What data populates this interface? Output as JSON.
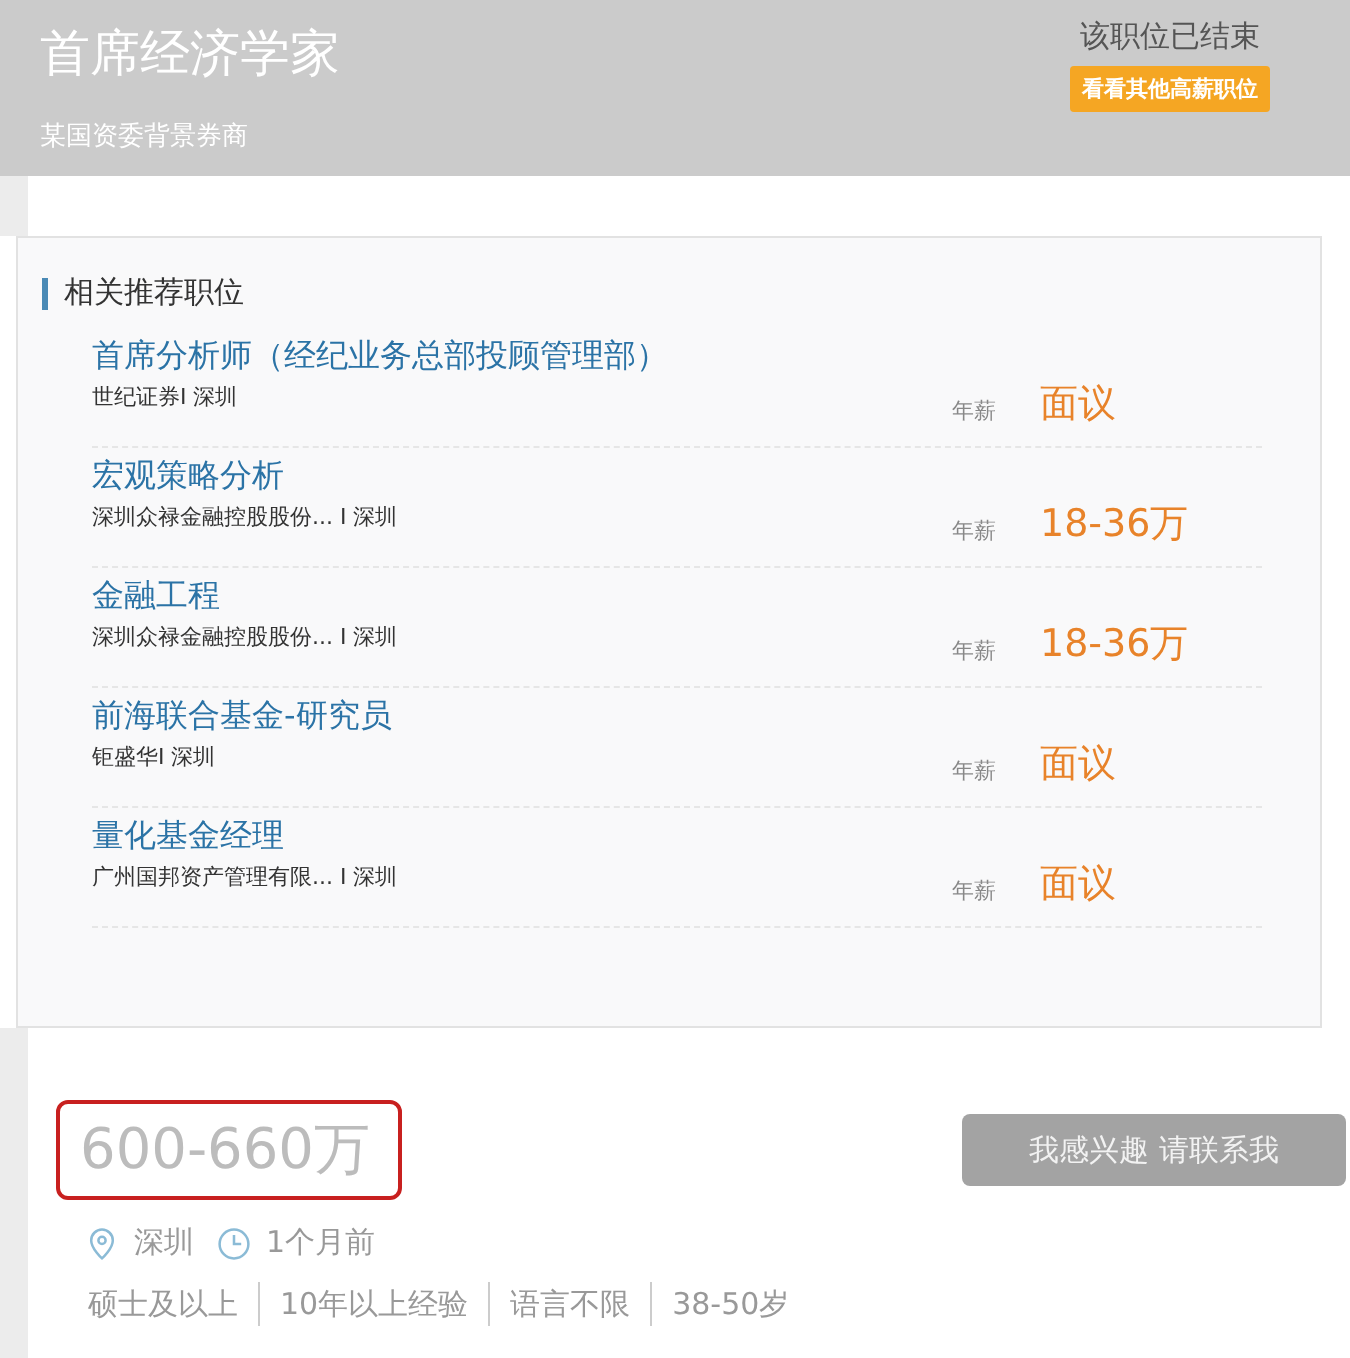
{
  "header": {
    "title": "首席经济学家",
    "subtitle": "某国资委背景券商",
    "status": "该职位已结束",
    "action": "看看其他高薪职位"
  },
  "related": {
    "heading": "相关推荐职位",
    "items": [
      {
        "title": "首席分析师（经纪业务总部投顾管理部）",
        "company": "世纪证券I 深圳",
        "salary_label": "年薪",
        "salary": "面议"
      },
      {
        "title": "宏观策略分析",
        "company": "深圳众禄金融控股股份... I 深圳",
        "salary_label": "年薪",
        "salary": "18-36万"
      },
      {
        "title": "金融工程",
        "company": "深圳众禄金融控股股份... I 深圳",
        "salary_label": "年薪",
        "salary": "18-36万"
      },
      {
        "title": "前海联合基金-研究员",
        "company": "钜盛华I 深圳",
        "salary_label": "年薪",
        "salary": "面议"
      },
      {
        "title": "量化基金经理",
        "company": "广州国邦资产管理有限... I 深圳",
        "salary_label": "年薪",
        "salary": "面议"
      }
    ]
  },
  "job": {
    "salary": "600-660万",
    "highlighted": true,
    "apply_button": {
      "label": "我感兴趣 请联系我",
      "disabled": true
    },
    "location": "深圳",
    "posted": "1个月前",
    "tags": [
      "硕士及以上",
      "10年以上经验",
      "语言不限",
      "38-50岁"
    ]
  }
}
